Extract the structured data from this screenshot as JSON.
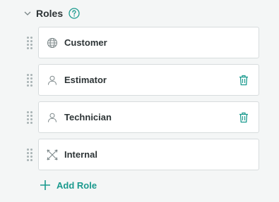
{
  "section": {
    "title": "Roles",
    "help_icon": "question-circle-icon",
    "collapse_icon": "chevron-down-icon"
  },
  "roles": [
    {
      "label": "Customer",
      "icon": "globe-icon",
      "deletable": false
    },
    {
      "label": "Estimator",
      "icon": "user-icon",
      "deletable": true
    },
    {
      "label": "Technician",
      "icon": "user-icon",
      "deletable": true
    },
    {
      "label": "Internal",
      "icon": "cross-arrows-icon",
      "deletable": false
    }
  ],
  "add_role": {
    "label": "Add Role",
    "icon": "plus-icon"
  },
  "colors": {
    "accent": "#1a9a8e",
    "text": "#2d3436",
    "border": "#d7dcdd",
    "handle": "#a8b2b4",
    "icon": "#7a8587",
    "background": "#f4f6f6"
  }
}
